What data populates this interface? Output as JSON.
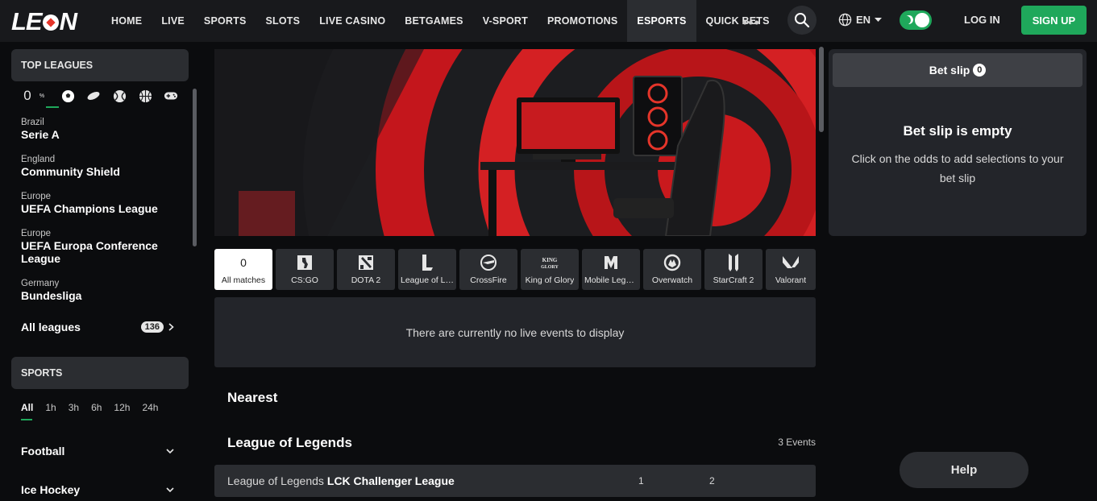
{
  "brand": {
    "logo_left": "LE",
    "logo_right": "N"
  },
  "nav": {
    "items": [
      "HOME",
      "LIVE",
      "SPORTS",
      "SLOTS",
      "LIVE CASINO",
      "BETGAMES",
      "V-SPORT",
      "PROMOTIONS",
      "ESPORTS",
      "QUICK BETS"
    ],
    "active": "ESPORTS",
    "language": "EN",
    "login_label": "LOG IN",
    "signup_label": "SIGN UP"
  },
  "sidebar": {
    "top_leagues_title": "TOP LEAGUES",
    "sport_icons": [
      "esports-zero-icon",
      "soccer-ball-icon",
      "hockey-puck-icon",
      "tennis-ball-icon",
      "basketball-icon",
      "gamepad-icon"
    ],
    "zero_label": "0",
    "zero_suffix": "%",
    "leagues": [
      {
        "country": "Brazil",
        "name": "Serie A"
      },
      {
        "country": "England",
        "name": "Community Shield"
      },
      {
        "country": "Europe",
        "name": "UEFA Champions League"
      },
      {
        "country": "Europe",
        "name": "UEFA Europa Conference League"
      },
      {
        "country": "Germany",
        "name": "Bundesliga"
      }
    ],
    "all_leagues_label": "All leagues",
    "all_leagues_count": "136",
    "sports_title": "SPORTS",
    "time_filters": [
      "All",
      "1h",
      "3h",
      "6h",
      "12h",
      "24h"
    ],
    "sports": [
      "Football",
      "Ice Hockey"
    ]
  },
  "main": {
    "tabs": [
      {
        "label": "All matches",
        "count": "0",
        "icon": "count"
      },
      {
        "label": "CS:GO",
        "icon": "csgo-icon"
      },
      {
        "label": "DOTA 2",
        "icon": "dota2-icon"
      },
      {
        "label": "League of Legends",
        "icon": "lol-icon"
      },
      {
        "label": "CrossFire",
        "icon": "crossfire-icon"
      },
      {
        "label": "King of Glory",
        "icon": "king-of-glory-icon"
      },
      {
        "label": "Mobile Legends",
        "icon": "mobile-legends-icon"
      },
      {
        "label": "Overwatch",
        "icon": "overwatch-icon"
      },
      {
        "label": "StarCraft 2",
        "icon": "starcraft2-icon"
      },
      {
        "label": "Valorant",
        "icon": "valorant-icon"
      }
    ],
    "no_events_text": "There are currently no live events to display",
    "nearest_title": "Nearest",
    "section_title": "League of Legends",
    "events_count": "3 Events",
    "league_row": {
      "game": "League of Legends",
      "league": "LCK Challenger League",
      "col1": "1",
      "col2": "2"
    }
  },
  "betslip": {
    "title": "Bet slip",
    "count": "0",
    "empty_title": "Bet slip is empty",
    "empty_hint": "Click on the odds to add selections to your bet slip"
  },
  "help_label": "Help",
  "colors": {
    "accent": "#1fa85b",
    "brand_red": "#e5352a",
    "panel": "#2b2d31",
    "background": "#0b0c0e"
  }
}
